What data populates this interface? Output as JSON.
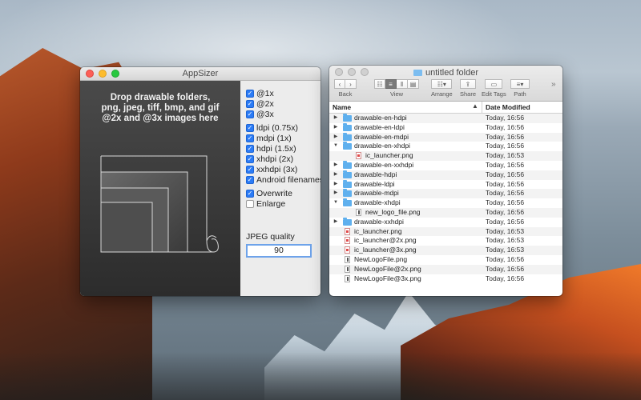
{
  "appsizer": {
    "title": "AppSizer",
    "drop_text": "Drop drawable folders,\npng, jpeg, tiff, bmp, and gif\n@2x and @3x images here",
    "options": [
      {
        "label": "@1x",
        "checked": true
      },
      {
        "label": "@2x",
        "checked": true
      },
      {
        "label": "@3x",
        "checked": true
      },
      {
        "label": "ldpi (0.75x)",
        "checked": true
      },
      {
        "label": "mdpi (1x)",
        "checked": true
      },
      {
        "label": "hdpi (1.5x)",
        "checked": true
      },
      {
        "label": "xhdpi (2x)",
        "checked": true
      },
      {
        "label": "xxhdpi (3x)",
        "checked": true
      },
      {
        "label": "Android filenames",
        "checked": true
      },
      {
        "label": "Overwrite",
        "checked": true
      },
      {
        "label": "Enlarge",
        "checked": false
      }
    ],
    "jpeg_quality_label": "JPEG quality",
    "jpeg_quality_value": "90",
    "colors": {
      "accent": "#2c7cf6"
    }
  },
  "finder": {
    "title": "untitled folder",
    "toolbar": {
      "back_label": "Back",
      "view_label": "View",
      "arrange_label": "Arrange",
      "share_label": "Share",
      "edit_tags_label": "Edit Tags",
      "path_label": "Path",
      "overflow": "»"
    },
    "columns": {
      "name": "Name",
      "date": "Date Modified"
    },
    "rows": [
      {
        "name": "drawable-en-hdpi",
        "date": "Today, 16:56",
        "kind": "folder",
        "depth": 0,
        "disclosure": "collapsed"
      },
      {
        "name": "drawable-en-ldpi",
        "date": "Today, 16:56",
        "kind": "folder",
        "depth": 0,
        "disclosure": "collapsed"
      },
      {
        "name": "drawable-en-mdpi",
        "date": "Today, 16:56",
        "kind": "folder",
        "depth": 0,
        "disclosure": "collapsed"
      },
      {
        "name": "drawable-en-xhdpi",
        "date": "Today, 16:56",
        "kind": "folder",
        "depth": 0,
        "disclosure": "expanded"
      },
      {
        "name": "ic_launcher.png",
        "date": "Today, 16:53",
        "kind": "png",
        "depth": 1,
        "disclosure": "none"
      },
      {
        "name": "drawable-en-xxhdpi",
        "date": "Today, 16:56",
        "kind": "folder",
        "depth": 0,
        "disclosure": "collapsed"
      },
      {
        "name": "drawable-hdpi",
        "date": "Today, 16:56",
        "kind": "folder",
        "depth": 0,
        "disclosure": "collapsed"
      },
      {
        "name": "drawable-ldpi",
        "date": "Today, 16:56",
        "kind": "folder",
        "depth": 0,
        "disclosure": "collapsed"
      },
      {
        "name": "drawable-mdpi",
        "date": "Today, 16:56",
        "kind": "folder",
        "depth": 0,
        "disclosure": "collapsed"
      },
      {
        "name": "drawable-xhdpi",
        "date": "Today, 16:56",
        "kind": "folder",
        "depth": 0,
        "disclosure": "expanded"
      },
      {
        "name": "new_logo_file.png",
        "date": "Today, 16:56",
        "kind": "tall",
        "depth": 1,
        "disclosure": "none"
      },
      {
        "name": "drawable-xxhdpi",
        "date": "Today, 16:56",
        "kind": "folder",
        "depth": 0,
        "disclosure": "collapsed"
      },
      {
        "name": "ic_launcher.png",
        "date": "Today, 16:53",
        "kind": "png",
        "depth": 0,
        "disclosure": "none"
      },
      {
        "name": "ic_launcher@2x.png",
        "date": "Today, 16:53",
        "kind": "png",
        "depth": 0,
        "disclosure": "none"
      },
      {
        "name": "ic_launcher@3x.png",
        "date": "Today, 16:53",
        "kind": "png",
        "depth": 0,
        "disclosure": "none"
      },
      {
        "name": "NewLogoFile.png",
        "date": "Today, 16:56",
        "kind": "tall",
        "depth": 0,
        "disclosure": "none"
      },
      {
        "name": "NewLogoFile@2x.png",
        "date": "Today, 16:56",
        "kind": "tall",
        "depth": 0,
        "disclosure": "none"
      },
      {
        "name": "NewLogoFile@3x.png",
        "date": "Today, 16:56",
        "kind": "tall",
        "depth": 0,
        "disclosure": "none"
      }
    ]
  }
}
